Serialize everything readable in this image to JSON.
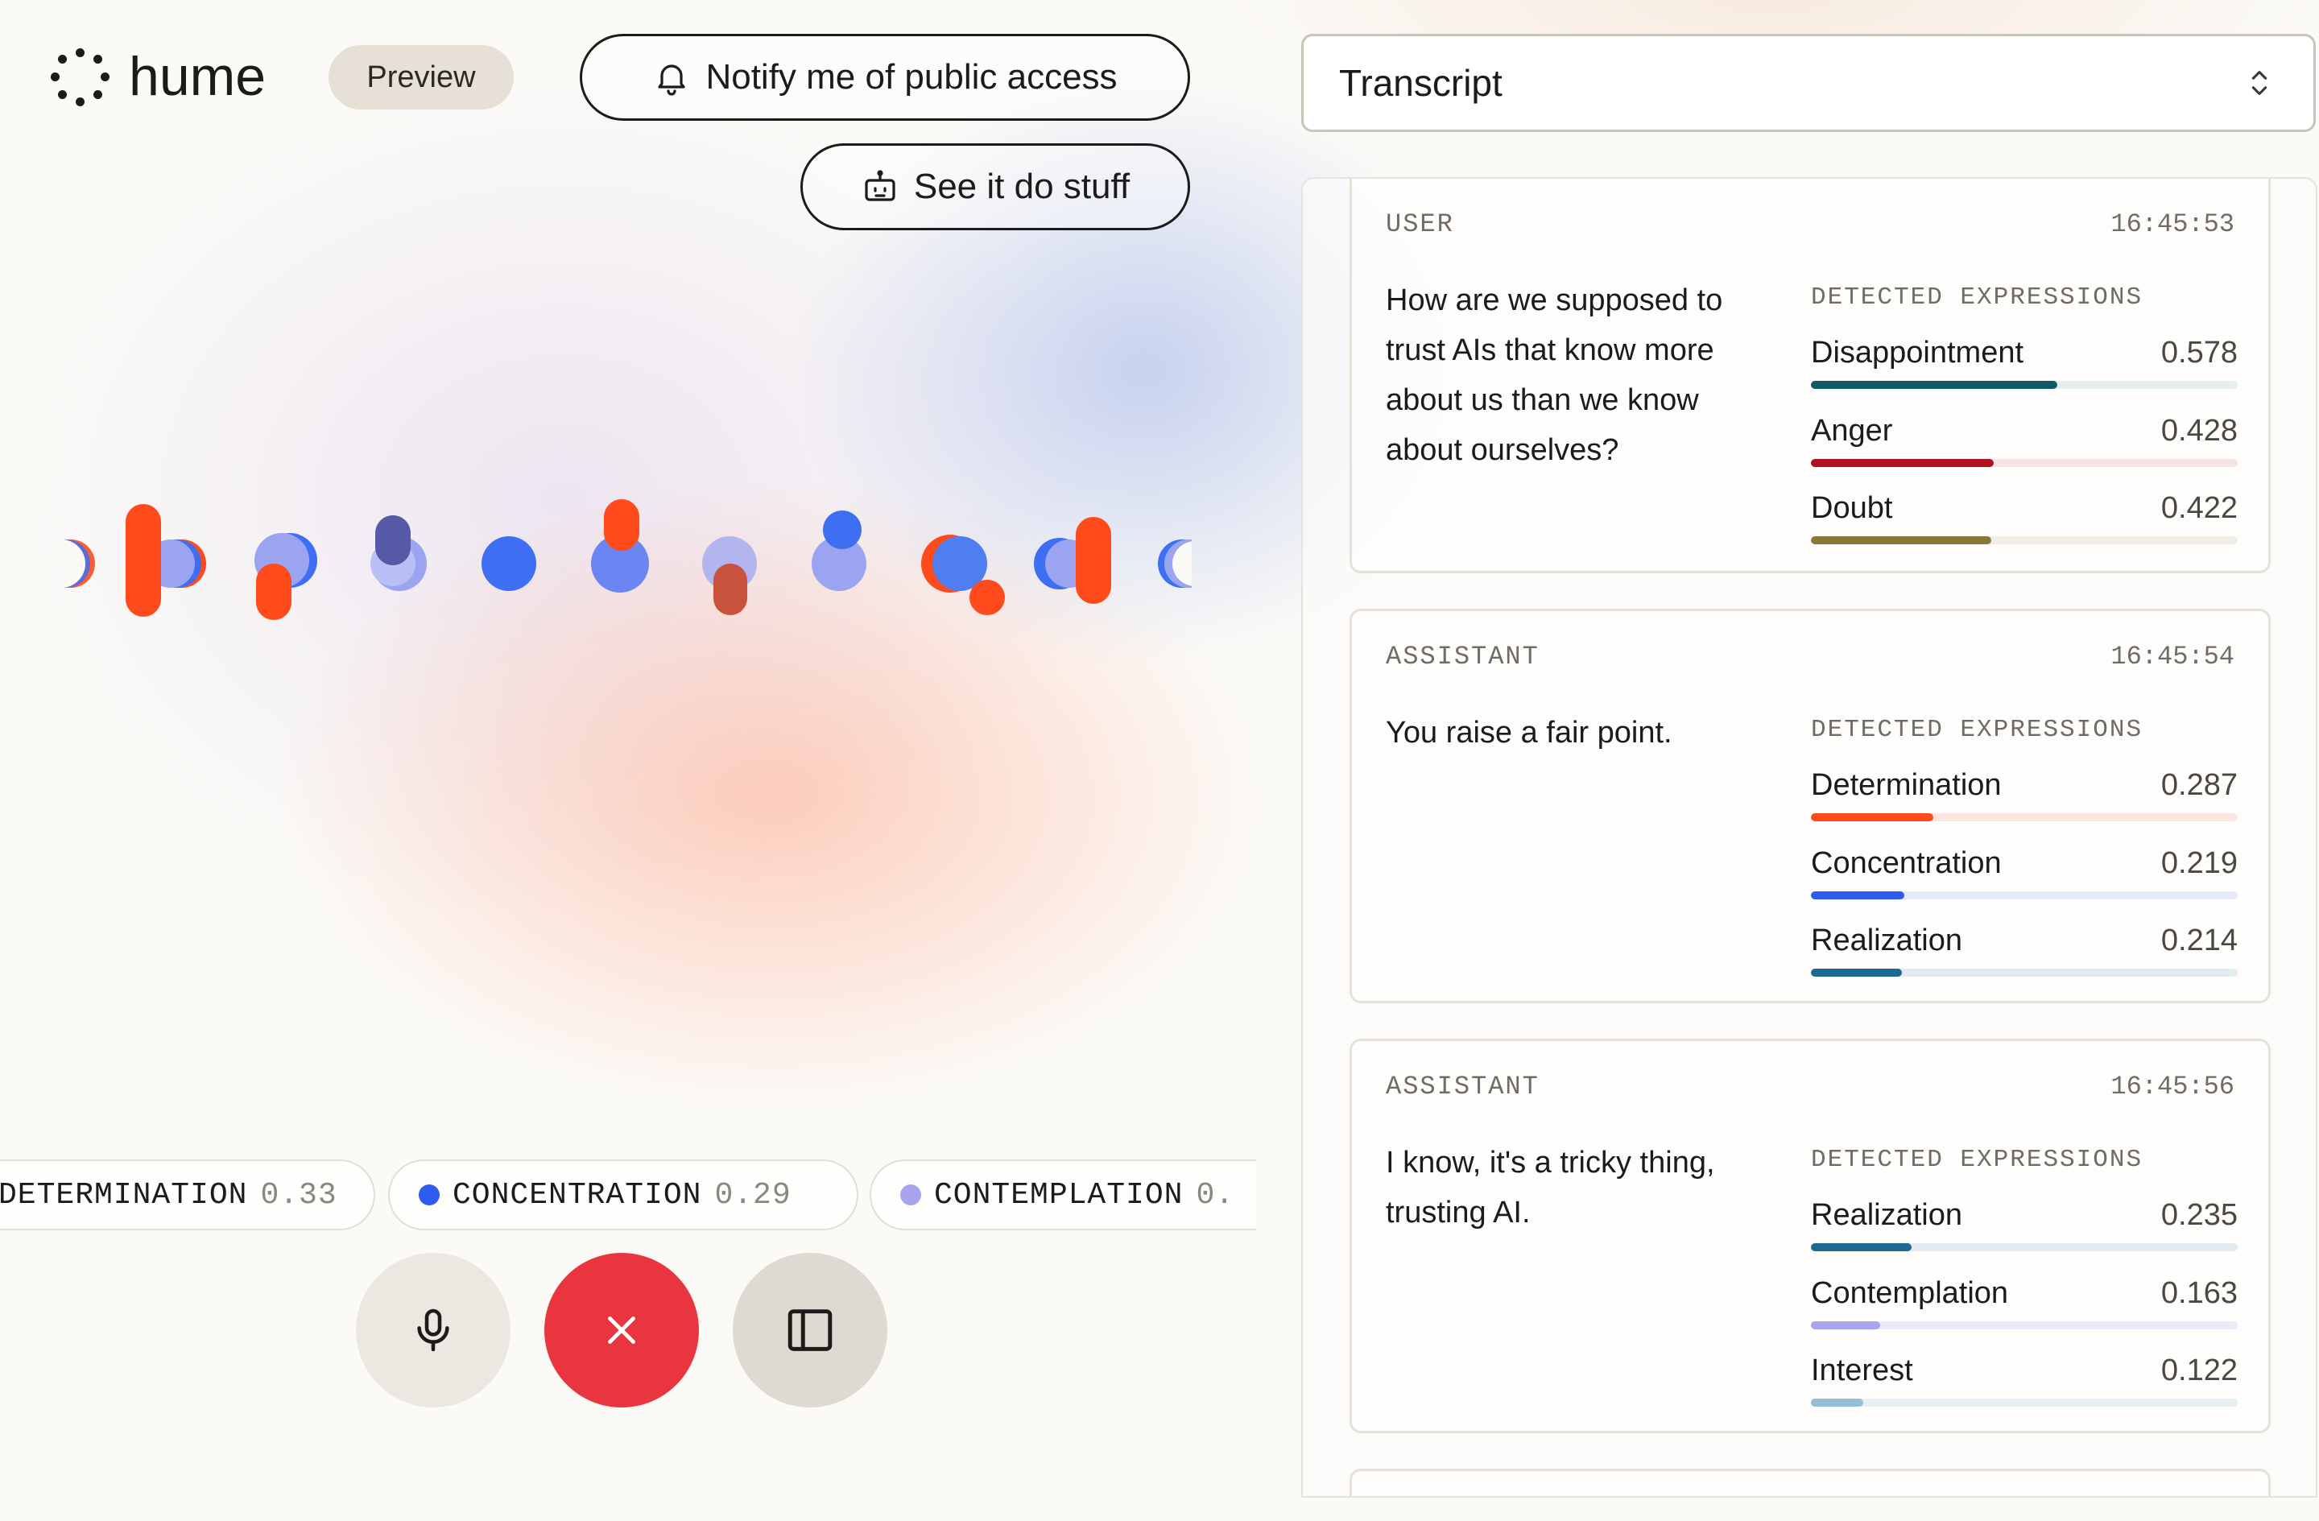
{
  "header": {
    "logo_text": "hume",
    "preview_label": "Preview",
    "notify_label": "Notify me of public access",
    "notify_icon": "bell-icon",
    "stuff_label": "See it do stuff",
    "stuff_icon": "robot-icon"
  },
  "visualizer": {
    "colors": [
      "#ff4a1c",
      "#3e6ef2",
      "#9aa4f0",
      "#5659a8",
      "#c8523c"
    ]
  },
  "emotion_chips": [
    {
      "name": "DETERMINATION",
      "score": "0.33",
      "color": "#ff4a1c"
    },
    {
      "name": "CONCENTRATION",
      "score": "0.29",
      "color": "#2f5cf0"
    },
    {
      "name": "CONTEMPLATION",
      "score": "0.",
      "color": "#a8a4ee"
    }
  ],
  "controls": {
    "mic_icon": "microphone-icon",
    "end_icon": "close-icon",
    "sidebar_icon": "sidebar-toggle-icon"
  },
  "view_select": {
    "value": "Transcript",
    "icon": "chevron-updown-icon"
  },
  "transcript": {
    "expressions_heading": "DETECTED EXPRESSIONS",
    "messages": [
      {
        "role": "USER",
        "time": "16:45:53",
        "text": "How are we supposed to trust AIs that know more about us than we know about ourselves?",
        "expressions": [
          {
            "label": "Disappointment",
            "value": "0.578",
            "color": "#0f5a66",
            "track": "#e6eef0"
          },
          {
            "label": "Anger",
            "value": "0.428",
            "color": "#b0101f",
            "track": "#f6e4e5"
          },
          {
            "label": "Doubt",
            "value": "0.422",
            "color": "#8a7a3a",
            "track": "#efede4"
          }
        ]
      },
      {
        "role": "ASSISTANT",
        "time": "16:45:54",
        "text": "You raise a fair point.",
        "expressions": [
          {
            "label": "Determination",
            "value": "0.287",
            "color": "#ff4a1c",
            "track": "#fbe7e1"
          },
          {
            "label": "Concentration",
            "value": "0.219",
            "color": "#2f5cf0",
            "track": "#e4eafb"
          },
          {
            "label": "Realization",
            "value": "0.214",
            "color": "#1d6a92",
            "track": "#e2ebf0"
          }
        ]
      },
      {
        "role": "ASSISTANT",
        "time": "16:45:56",
        "text": "I know, it's a tricky thing, trusting AI.",
        "expressions": [
          {
            "label": "Realization",
            "value": "0.235",
            "color": "#1d6a92",
            "track": "#e2ebf0"
          },
          {
            "label": "Contemplation",
            "value": "0.163",
            "color": "#a8a4ee",
            "track": "#eceaf8"
          },
          {
            "label": "Interest",
            "value": "0.122",
            "color": "#93c0d8",
            "track": "#e8eff3"
          }
        ]
      }
    ]
  }
}
